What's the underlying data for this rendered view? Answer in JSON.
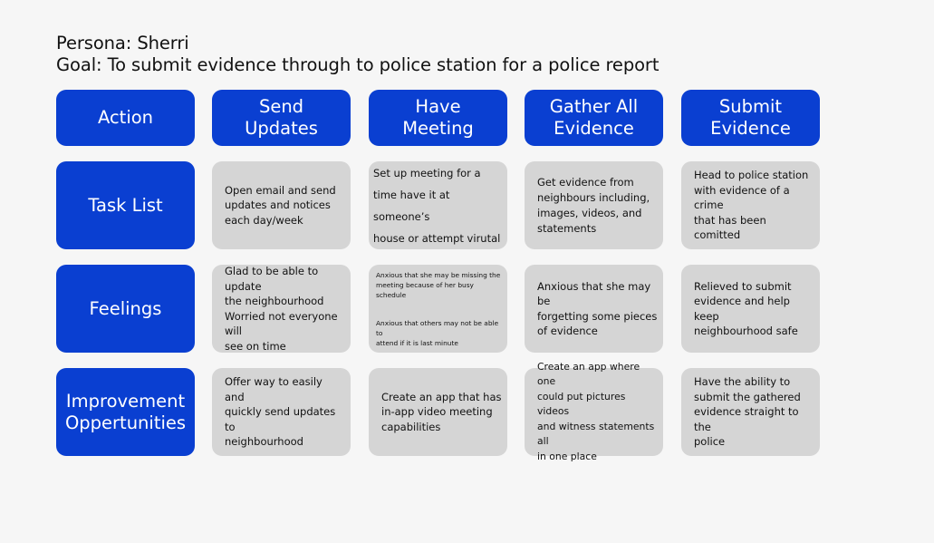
{
  "header": {
    "persona": "Persona: Sherri",
    "goal": "Goal: To submit evidence through to police station for a police report"
  },
  "rows": {
    "action": {
      "label": "Action",
      "cells": [
        "Send\nUpdates",
        "Have\nMeeting",
        "Gather All\nEvidence",
        "Submit\nEvidence"
      ]
    },
    "task_list": {
      "label": "Task List",
      "cells": [
        "Open email and send\nupdates and notices\neach day/week",
        "Set up meeting for a\ntime have it at someone’s\nhouse or attempt virutal",
        "Get evidence from\nneighbours including,\nimages,  videos, and\nstatements",
        "Head to police station\nwith evidence of a crime\nthat has been comitted"
      ]
    },
    "feelings": {
      "label": "Feelings",
      "cells": [
        [
          "Glad to be able to update\nthe neighbourhood",
          "Worried not everyone will\nsee on time"
        ],
        [
          "Anxious that she may be missing the\nmeeting because of her busy schedule",
          "Anxious that others may not be able to\nattend if it is last minute"
        ],
        "Anxious that she may be\nforgetting some pieces\nof evidence",
        "Relieved to submit\nevidence and help keep\nneighbourhood safe"
      ]
    },
    "improvement": {
      "label": "Improvement\nOppertunities",
      "cells": [
        "Offer way to easily and\nquickly send updates to\nneighbourhood",
        "Create an app that has\nin-app video meeting\ncapabilities",
        "Create an app where one\ncould put pictures videos\nand witness statements all\nin one place",
        "Have the ability to\nsubmit the gathered\nevidence straight to the\npolice"
      ]
    }
  }
}
